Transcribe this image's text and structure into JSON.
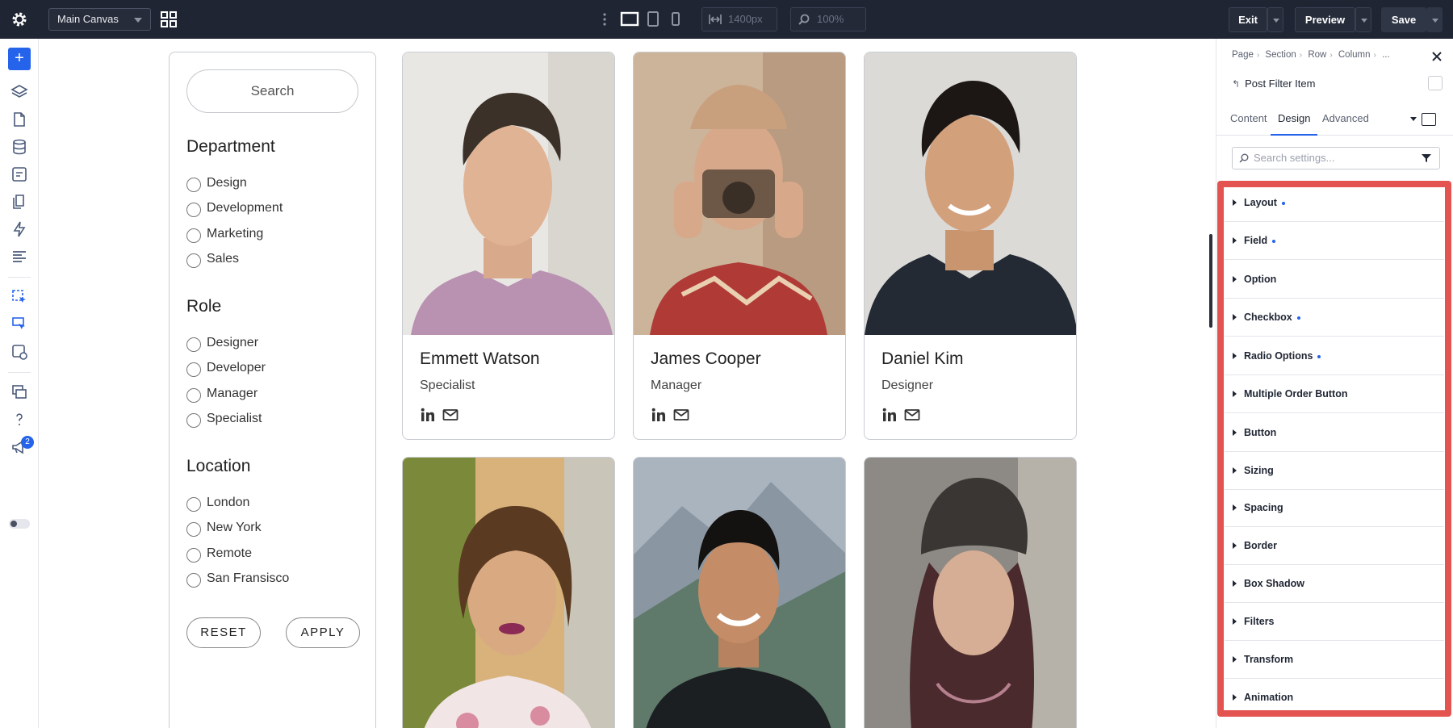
{
  "topbar": {
    "canvas_select": "Main Canvas",
    "width_value": "1400px",
    "zoom_value": "100%",
    "exit_label": "Exit",
    "preview_label": "Preview",
    "save_label": "Save",
    "icons": [
      "gear-icon",
      "grid-icon",
      "more-vertical-icon",
      "desktop-icon",
      "tablet-icon",
      "mobile-icon",
      "width-icon",
      "zoom-icon"
    ]
  },
  "left_toolbar": {
    "notifications_count": "2",
    "accent_color": "#2563eb"
  },
  "filter_panel": {
    "search_label": "Search",
    "groups": [
      {
        "heading": "Department",
        "options": [
          "Design",
          "Development",
          "Marketing",
          "Sales"
        ]
      },
      {
        "heading": "Role",
        "options": [
          "Designer",
          "Developer",
          "Manager",
          "Specialist"
        ]
      },
      {
        "heading": "Location",
        "options": [
          "London",
          "New York",
          "Remote",
          "San Fransisco"
        ]
      }
    ],
    "reset_label": "RESET",
    "apply_label": "APPLY"
  },
  "cards": [
    {
      "name": "Emmett Watson",
      "role": "Specialist"
    },
    {
      "name": "James Cooper",
      "role": "Manager"
    },
    {
      "name": "Daniel Kim",
      "role": "Designer"
    },
    {
      "name": "",
      "role": ""
    },
    {
      "name": "",
      "role": ""
    },
    {
      "name": "",
      "role": ""
    }
  ],
  "settings_panel": {
    "breadcrumb": [
      "Page",
      "Section",
      "Row",
      "Column",
      "..."
    ],
    "title": "Post Filter Item",
    "tabs": [
      "Content",
      "Design",
      "Advanced"
    ],
    "active_tab": "Design",
    "search_placeholder": "Search settings...",
    "groups": [
      {
        "label": "Layout",
        "modified": true
      },
      {
        "label": "Field",
        "modified": true
      },
      {
        "label": "Option",
        "modified": false
      },
      {
        "label": "Checkbox",
        "modified": true
      },
      {
        "label": "Radio Options",
        "modified": true
      },
      {
        "label": "Multiple Order Button",
        "modified": false
      },
      {
        "label": "Button",
        "modified": false
      },
      {
        "label": "Sizing",
        "modified": false
      },
      {
        "label": "Spacing",
        "modified": false
      },
      {
        "label": "Border",
        "modified": false
      },
      {
        "label": "Box Shadow",
        "modified": false
      },
      {
        "label": "Filters",
        "modified": false
      },
      {
        "label": "Transform",
        "modified": false
      },
      {
        "label": "Animation",
        "modified": false
      }
    ],
    "highlight_color": "#e3534f"
  }
}
